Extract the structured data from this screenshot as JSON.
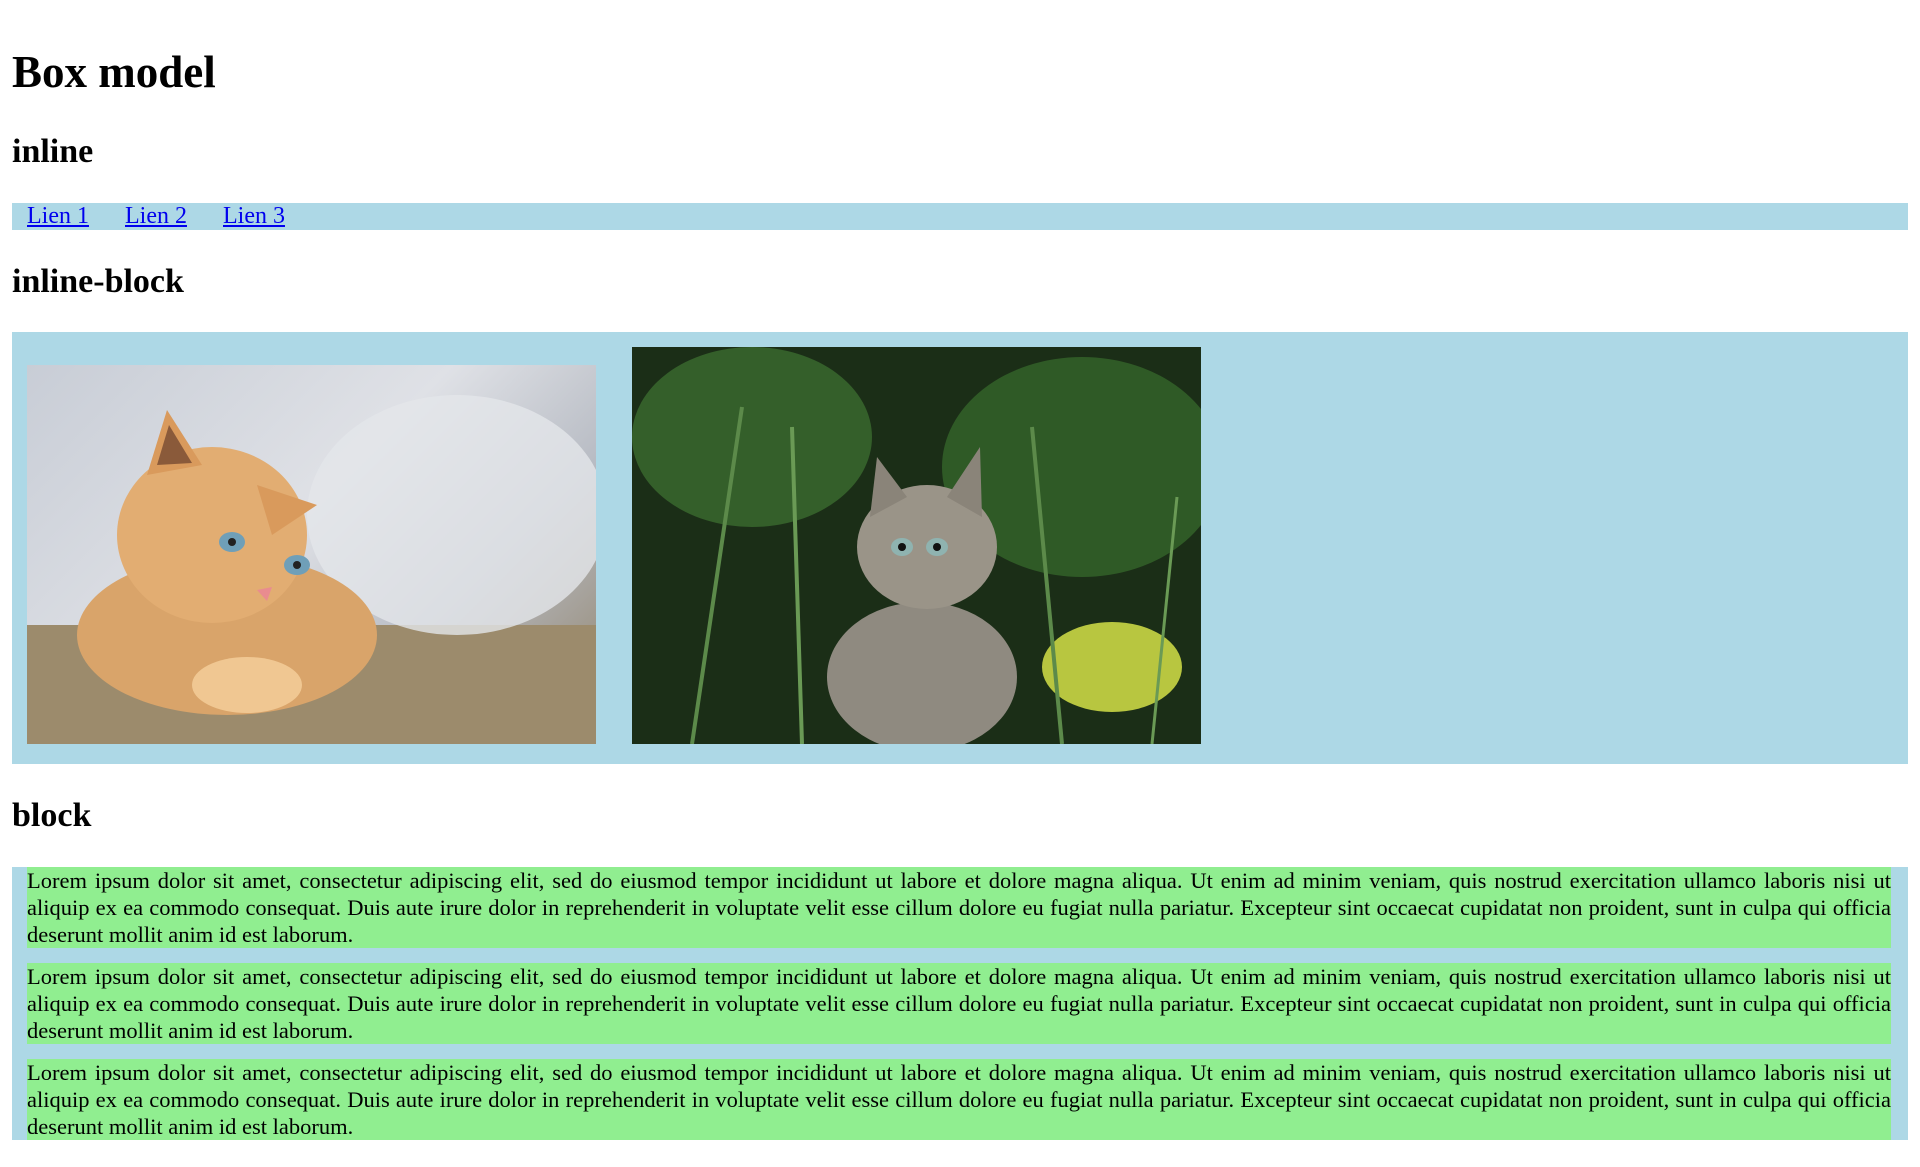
{
  "page": {
    "title": "Box model"
  },
  "sections": {
    "inline": {
      "heading": "inline",
      "links": [
        "Lien 1",
        "Lien 2",
        "Lien 3"
      ]
    },
    "inline_block": {
      "heading": "inline-block",
      "images": [
        {
          "subject": "orange kitten lying on a couch"
        },
        {
          "subject": "grey tabby kitten sitting in plants"
        }
      ]
    },
    "block": {
      "heading": "block",
      "paragraphs": [
        "Lorem ipsum dolor sit amet, consectetur adipiscing elit, sed do eiusmod tempor incididunt ut labore et dolore magna aliqua. Ut enim ad minim veniam, quis nostrud exercitation ullamco laboris nisi ut aliquip ex ea commodo consequat. Duis aute irure dolor in reprehenderit in voluptate velit esse cillum dolore eu fugiat nulla pariatur. Excepteur sint occaecat cupidatat non proident, sunt in culpa qui officia deserunt mollit anim id est laborum.",
        "Lorem ipsum dolor sit amet, consectetur adipiscing elit, sed do eiusmod tempor incididunt ut labore et dolore magna aliqua. Ut enim ad minim veniam, quis nostrud exercitation ullamco laboris nisi ut aliquip ex ea commodo consequat. Duis aute irure dolor in reprehenderit in voluptate velit esse cillum dolore eu fugiat nulla pariatur. Excepteur sint occaecat cupidatat non proident, sunt in culpa qui officia deserunt mollit anim id est laborum.",
        "Lorem ipsum dolor sit amet, consectetur adipiscing elit, sed do eiusmod tempor incididunt ut labore et dolore magna aliqua. Ut enim ad minim veniam, quis nostrud exercitation ullamco laboris nisi ut aliquip ex ea commodo consequat. Duis aute irure dolor in reprehenderit in voluptate velit esse cillum dolore eu fugiat nulla pariatur. Excepteur sint occaecat cupidatat non proident, sunt in culpa qui officia deserunt mollit anim id est laborum."
      ]
    }
  },
  "colors": {
    "container_background": "#add8e6",
    "paragraph_background": "#90ee90",
    "link_color": "#0000ee"
  }
}
